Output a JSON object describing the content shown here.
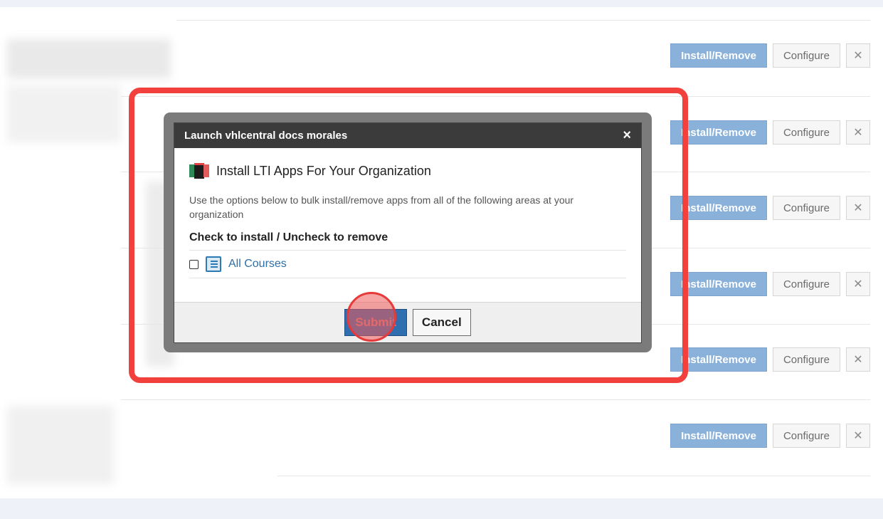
{
  "rows": [
    {
      "install_label": "Install/Remove",
      "configure_label": "Configure",
      "remove_icon": "close-icon",
      "remove_glyph": "✕"
    },
    {
      "install_label": "Install/Remove",
      "configure_label": "Configure",
      "remove_icon": "close-icon",
      "remove_glyph": "✕"
    },
    {
      "install_label": "Install/Remove",
      "configure_label": "Configure",
      "remove_icon": "close-icon",
      "remove_glyph": "✕"
    },
    {
      "install_label": "Install/Remove",
      "configure_label": "Configure",
      "remove_icon": "close-icon",
      "remove_glyph": "✕"
    },
    {
      "install_label": "Install/Remove",
      "configure_label": "Configure",
      "remove_icon": "close-icon",
      "remove_glyph": "✕"
    },
    {
      "install_label": "Install/Remove",
      "configure_label": "Configure",
      "remove_icon": "close-icon",
      "remove_glyph": "✕"
    }
  ],
  "modal": {
    "title": "Launch vhlcentral docs morales",
    "close_glyph": "×",
    "heading": "Install LTI Apps For Your Organization",
    "description": "Use the options below to bulk install/remove apps from all of the following areas at your organization",
    "subheading": "Check to install / Uncheck to remove",
    "options": [
      {
        "label": "All Courses",
        "checked": false,
        "icon": "book-icon"
      }
    ],
    "submit_label": "Submit",
    "cancel_label": "Cancel"
  },
  "colors": {
    "install_button": "#8ab1da",
    "highlight": "#f2413c",
    "modal_title_bar": "#3b3b3b",
    "submit_button": "#2f6fb0"
  }
}
